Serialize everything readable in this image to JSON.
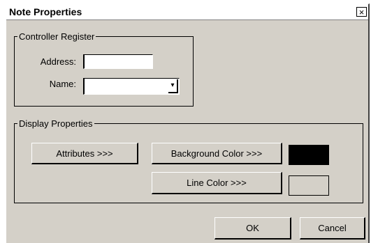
{
  "window": {
    "title": "Note Properties",
    "close_glyph": "×"
  },
  "controller_register": {
    "legend": "Controller Register",
    "address_label": "Address:",
    "address_value": "",
    "name_label": "Name:",
    "name_value": "",
    "dropdown_glyph": "▾"
  },
  "display_properties": {
    "legend": "Display Properties",
    "attributes_button": "Attributes >>>",
    "background_color_button": "Background Color >>>",
    "line_color_button": "Line Color >>>",
    "background_swatch_color": "#000000",
    "line_swatch_color": "#d4d0c8"
  },
  "footer": {
    "ok_label": "OK",
    "cancel_label": "Cancel"
  }
}
